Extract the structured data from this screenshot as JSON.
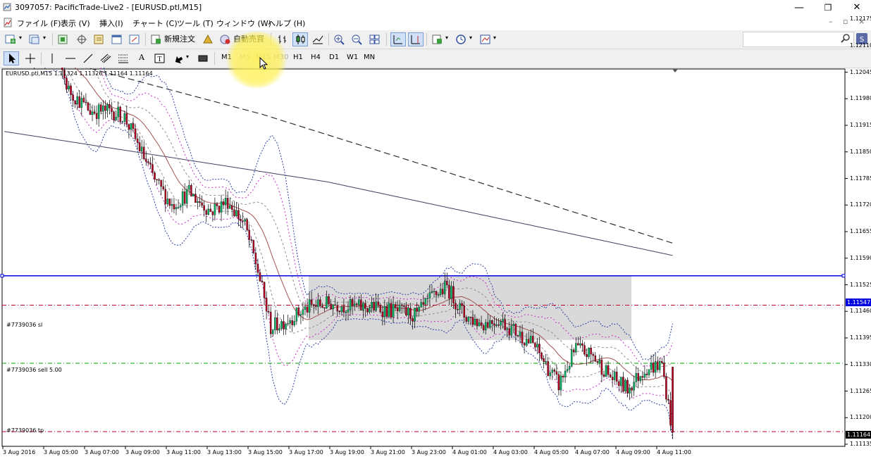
{
  "window": {
    "title": "3097057: PacificTrade-Live2 - [EURUSD.ptl,M15]",
    "minimize": "—",
    "restore": "❐",
    "close": "✕"
  },
  "menu": [
    "ファイル (F)",
    "表示 (V)",
    "挿入(I)",
    "チャート (C)",
    "ツール (T)",
    "ウィンドウ (W)",
    "ヘルプ (H)"
  ],
  "mdi": {
    "min": "–",
    "restore": "▫",
    "close": "×"
  },
  "toolbar1": {
    "new_order": "新規注文",
    "auto_trade": "自動売買"
  },
  "toolbar2": {
    "timeframes": [
      {
        "label": "M1",
        "disabled": false
      },
      {
        "label": "M5",
        "disabled": true
      },
      {
        "label": "M15",
        "disabled": true
      },
      {
        "label": "M30",
        "disabled": true
      },
      {
        "label": "H1",
        "disabled": false
      },
      {
        "label": "H4",
        "disabled": false
      },
      {
        "label": "D1",
        "disabled": false
      },
      {
        "label": "W1",
        "disabled": false
      },
      {
        "label": "MN",
        "disabled": false
      }
    ]
  },
  "search": {
    "placeholder": ""
  },
  "chart": {
    "header": "EURUSD.ptl,M15  1.11324 1.11326 1.11164 1.11164",
    "order_labels": {
      "sl": "#7739036 sl",
      "sell": "#7739036 sell 5.00",
      "tp": "#7739036 tp"
    },
    "current_price": "1.11164",
    "hline_price": "1.11547",
    "colors": {
      "bull": "#00b060",
      "bear": "#b00020",
      "hline": "#0000e0",
      "sl": "#c0002a",
      "entry": "#00a000",
      "range_box": "#cfcfcf"
    }
  },
  "chart_data": {
    "type": "candlestick",
    "title": "EURUSD.ptl,M15",
    "y_ticks": [
      "1.12175",
      "1.12110",
      "1.12045",
      "1.11980",
      "1.11915",
      "1.11850",
      "1.11785",
      "1.11720",
      "1.11655",
      "1.11590",
      "1.11525",
      "1.11460",
      "1.11395",
      "1.11330",
      "1.11265",
      "1.11200",
      "1.11135"
    ],
    "x_ticks": [
      "3 Aug 2016",
      "3 Aug 05:00",
      "3 Aug 07:00",
      "3 Aug 09:00",
      "3 Aug 11:00",
      "3 Aug 13:00",
      "3 Aug 15:00",
      "3 Aug 17:00",
      "3 Aug 19:00",
      "3 Aug 21:00",
      "3 Aug 23:00",
      "4 Aug 01:00",
      "4 Aug 03:00",
      "4 Aug 05:00",
      "4 Aug 07:00",
      "4 Aug 09:00",
      "4 Aug 11:00"
    ],
    "ylim": [
      1.11135,
      1.12175
    ],
    "last_bar": {
      "open": 1.11324,
      "high": 1.11326,
      "low": 1.11164,
      "close": 1.11164
    },
    "levels": {
      "hline": 1.11547,
      "stop_loss": 1.11475,
      "entry": 1.11333,
      "take_profit": 1.11164
    },
    "grid": false
  }
}
